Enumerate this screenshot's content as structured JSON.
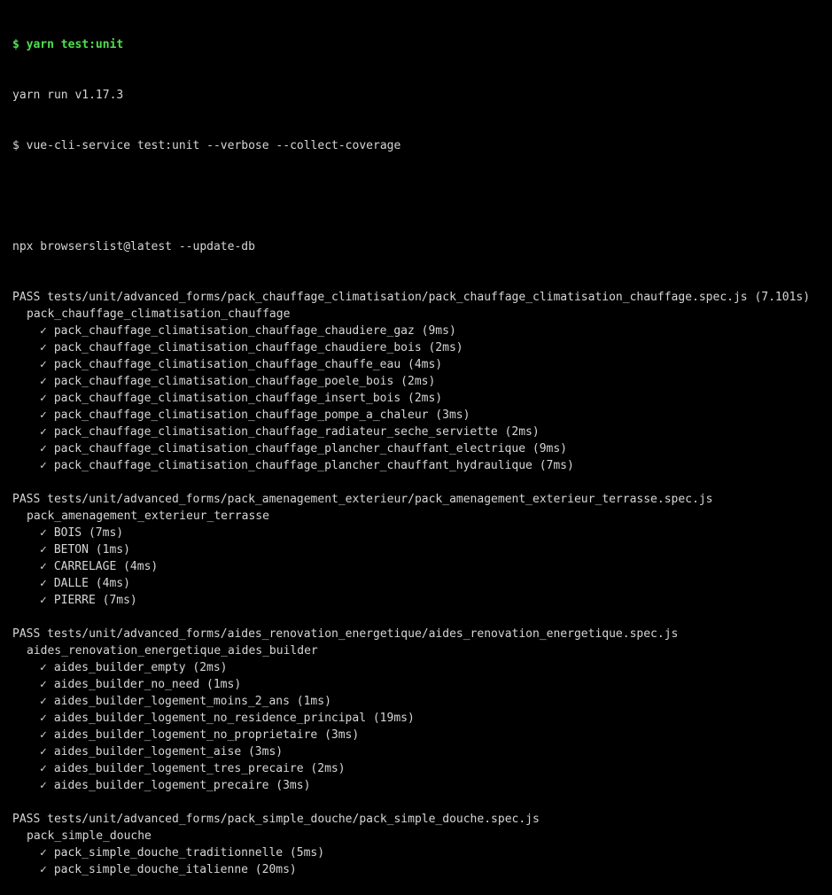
{
  "header": {
    "command": "$ yarn test:unit",
    "yarn_version": "yarn run v1.17.3",
    "service_command": "$ vue-cli-service test:unit --verbose --collect-coverage",
    "browserslist": "npx browserslist@latest --update-db"
  },
  "check_glyph": "✓",
  "suites": [
    {
      "pass_line": "PASS tests/unit/advanced_forms/pack_chauffage_climatisation/pack_chauffage_climatisation_chauffage.spec.js (7.101s)",
      "describe": "pack_chauffage_climatisation_chauffage",
      "tests": [
        "pack_chauffage_climatisation_chauffage_chaudiere_gaz (9ms)",
        "pack_chauffage_climatisation_chauffage_chaudiere_bois (2ms)",
        "pack_chauffage_climatisation_chauffage_chauffe_eau (4ms)",
        "pack_chauffage_climatisation_chauffage_poele_bois (2ms)",
        "pack_chauffage_climatisation_chauffage_insert_bois (2ms)",
        "pack_chauffage_climatisation_chauffage_pompe_a_chaleur (3ms)",
        "pack_chauffage_climatisation_chauffage_radiateur_seche_serviette (2ms)",
        "pack_chauffage_climatisation_chauffage_plancher_chauffant_electrique (9ms)",
        "pack_chauffage_climatisation_chauffage_plancher_chauffant_hydraulique (7ms)"
      ]
    },
    {
      "pass_line": "PASS tests/unit/advanced_forms/pack_amenagement_exterieur/pack_amenagement_exterieur_terrasse.spec.js",
      "describe": "pack_amenagement_exterieur_terrasse",
      "tests": [
        "BOIS (7ms)",
        "BETON (1ms)",
        "CARRELAGE (4ms)",
        "DALLE (4ms)",
        "PIERRE (7ms)"
      ]
    },
    {
      "pass_line": "PASS tests/unit/advanced_forms/aides_renovation_energetique/aides_renovation_energetique.spec.js",
      "describe": "aides_renovation_energetique_aides_builder",
      "tests": [
        "aides_builder_empty (2ms)",
        "aides_builder_no_need (1ms)",
        "aides_builder_logement_moins_2_ans (1ms)",
        "aides_builder_logement_no_residence_principal (19ms)",
        "aides_builder_logement_no_proprietaire (3ms)",
        "aides_builder_logement_aise (3ms)",
        "aides_builder_logement_tres_precaire (2ms)",
        "aides_builder_logement_precaire (3ms)"
      ]
    },
    {
      "pass_line": "PASS tests/unit/advanced_forms/pack_simple_douche/pack_simple_douche.spec.js",
      "describe": "pack_simple_douche",
      "tests": [
        "pack_simple_douche_traditionnelle (5ms)",
        "pack_simple_douche_italienne (20ms)"
      ]
    }
  ],
  "colors": {
    "background": "#000000",
    "text": "#d6d6d6",
    "prompt": "#4fe04f"
  }
}
